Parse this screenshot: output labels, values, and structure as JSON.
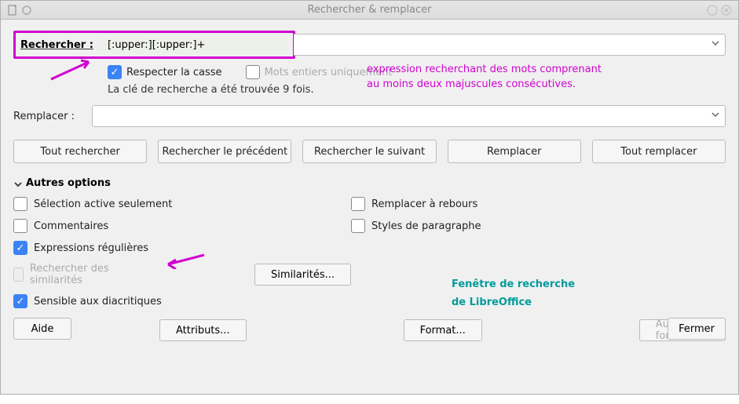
{
  "titlebar": {
    "title": "Rechercher & remplacer"
  },
  "search": {
    "label": "Rechercher :",
    "value": "[:upper:][:upper:]+"
  },
  "options_inline": {
    "match_case": "Respecter la casse",
    "whole_words": "Mots entiers uniquement"
  },
  "status": "La clé de recherche a été trouvée 9 fois.",
  "replace": {
    "label": "Remplacer :"
  },
  "buttons": {
    "find_all": "Tout rechercher",
    "find_prev": "Rechercher le précédent",
    "find_next": "Rechercher le suivant",
    "replace": "Remplacer",
    "replace_all": "Tout remplacer",
    "similarities": "Similarités...",
    "attributes": "Attributs...",
    "format": "Format...",
    "no_format": "Aucun format",
    "help": "Aide",
    "close": "Fermer"
  },
  "other_options": {
    "header": "Autres options",
    "selection_only": "Sélection active seulement",
    "comments": "Commentaires",
    "regex": "Expressions régulières",
    "similarities": "Rechercher des similarités",
    "diacritics": "Sensible aux diacritiques",
    "backwards": "Remplacer à rebours",
    "para_styles": "Styles de paragraphe"
  },
  "annotations": {
    "magenta1": "expression recherchant des mots comprenant",
    "magenta2": "au moins deux majuscules consécutives.",
    "teal1": "Fenêtre de recherche",
    "teal2": "de LibreOffice"
  }
}
